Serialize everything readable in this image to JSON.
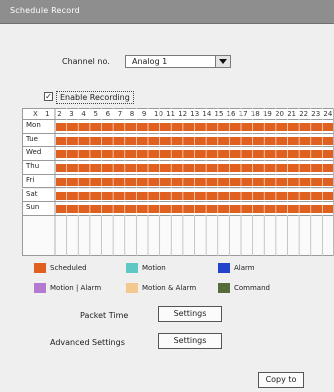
{
  "window": {
    "title": "Schedule Record"
  },
  "channel": {
    "label": "Channel no.",
    "value": "Analog 1"
  },
  "enable": {
    "label": "Enable Recording",
    "checked": true,
    "mark": "✓"
  },
  "hours": [
    "X",
    "1",
    "2",
    "3",
    "4",
    "5",
    "6",
    "7",
    "8",
    "9",
    "10",
    "11",
    "12",
    "13",
    "14",
    "15",
    "16",
    "17",
    "18",
    "19",
    "20",
    "21",
    "22",
    "23",
    "24"
  ],
  "days": [
    "Mon",
    "Tue",
    "Wed",
    "Thu",
    "Fri",
    "Sat",
    "Sun"
  ],
  "schedule_color": "#e06020",
  "legend": [
    {
      "label": "Scheduled",
      "color": "#e06020",
      "icon": "scheduled-swatch"
    },
    {
      "label": "Motion",
      "color": "#5fc7c4",
      "icon": "motion-swatch"
    },
    {
      "label": "Alarm",
      "color": "#2244cc",
      "icon": "alarm-swatch"
    },
    {
      "label": "Motion | Alarm",
      "color": "#b27ad0",
      "icon": "motion-or-alarm-swatch"
    },
    {
      "label": "Motion & Alarm",
      "color": "#f3c98f",
      "icon": "motion-and-alarm-swatch"
    },
    {
      "label": "Command",
      "color": "#556b3b",
      "icon": "command-swatch"
    }
  ],
  "packet_time": {
    "label": "Packet Time",
    "button": "Settings"
  },
  "advanced": {
    "label": "Advanced Settings",
    "button": "Settings"
  },
  "copy_to": {
    "label": "Copy to"
  }
}
